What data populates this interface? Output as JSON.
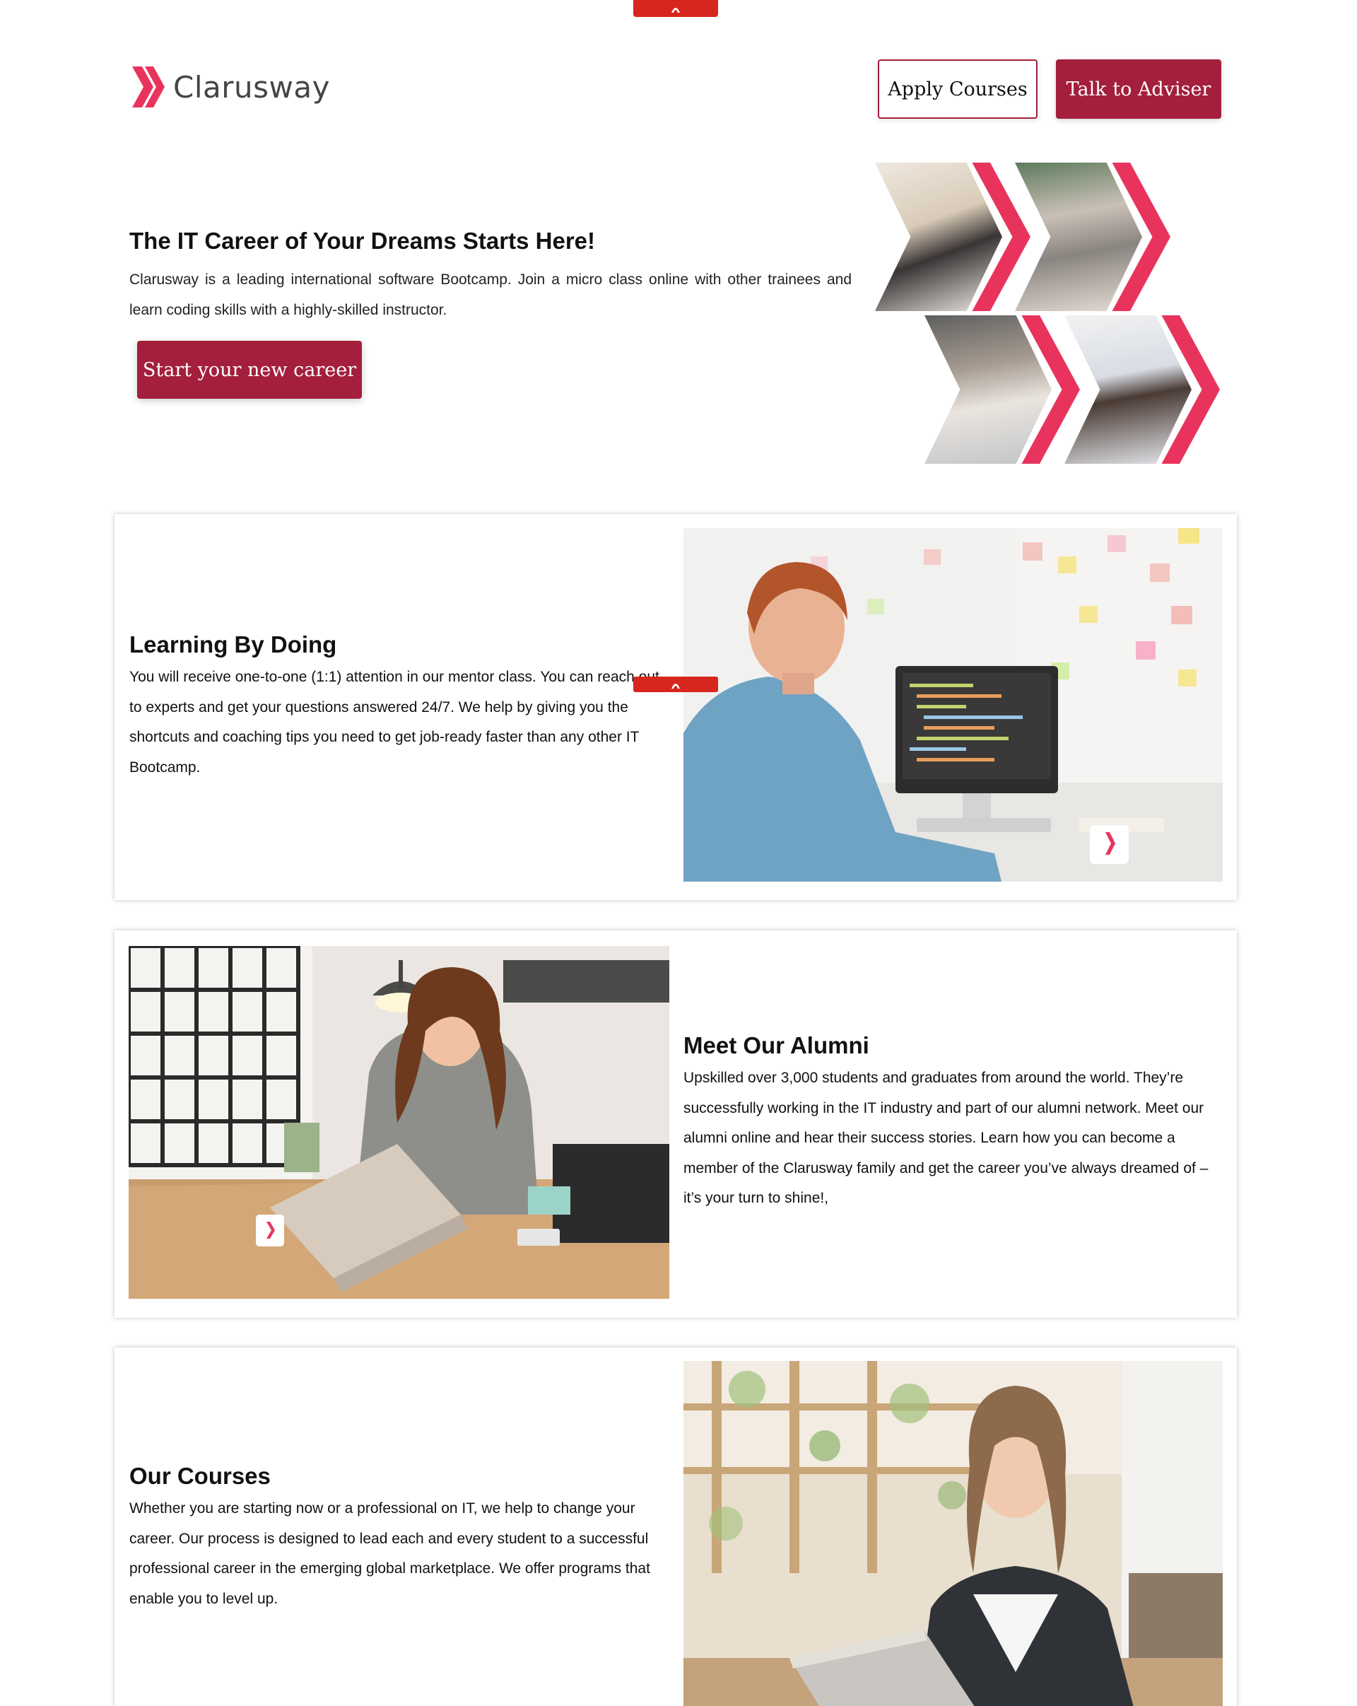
{
  "brand": {
    "name": "Clarusway",
    "accent": "#a31f3c",
    "logo_color": "#e8345d",
    "tab_color": "#d7261d"
  },
  "header": {
    "apply_label": "Apply Courses",
    "adviser_label": "Talk to Adviser"
  },
  "hero": {
    "title": "The IT Career of Your Dreams Starts Here!",
    "description": "Clarusway is a leading international software Bootcamp. Join a micro class online with other trainees and learn coding skills with a highly-skilled instructor.",
    "cta_label": "Start your new career"
  },
  "sections": [
    {
      "title": "Learning By Doing",
      "text": "You will receive one-to-one (1:1) attention in our mentor class. You can reach out to experts and get your questions answered 24/7. We help by giving you the shortcuts and coaching tips you need to get job-ready faster than any other IT Bootcamp."
    },
    {
      "title": "Meet Our Alumni",
      "text": "Upskilled over 3,000 students and graduates from around the world. They’re successfully working in the IT industry and part of our alumni network. Meet our alumni online and hear their success stories. Learn how you can become a member of the Clarusway family and get the career you’ve always dreamed of – it’s your turn to shine!,"
    },
    {
      "title": "Our Courses",
      "text": "Whether you are starting now or a professional on IT, we help to change your career. Our process is designed to lead each and every student to a successful professional career in the emerging global marketplace. We offer programs that enable you to level up."
    }
  ],
  "icons": {
    "logo": "double-chevron-icon",
    "tab": "arrow-up-icon"
  }
}
